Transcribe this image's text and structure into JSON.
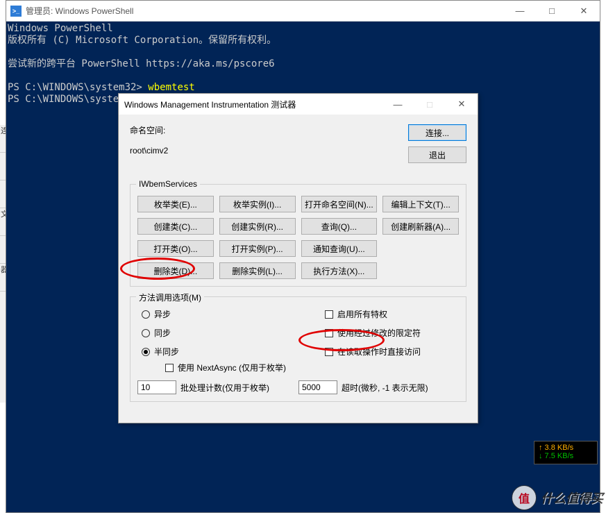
{
  "powershell": {
    "title": "管理员: Windows PowerShell",
    "lines": {
      "l1": "Windows PowerShell",
      "l2": "版权所有 (C) Microsoft Corporation。保留所有权利。",
      "l3": "尝试新的跨平台 PowerShell https://aka.ms/pscore6",
      "prompt1": "PS C:\\WINDOWS\\system32> ",
      "cmd1": "wbemtest",
      "prompt2": "PS C:\\WINDOWS\\system32> "
    }
  },
  "strip": {
    "a": "连",
    "b": " ",
    "c": " ",
    "d": "文",
    "e": " ",
    "f": "器"
  },
  "dialog": {
    "title": "Windows Management Instrumentation 测试器",
    "ns_label": "命名空间:",
    "ns_value": "root\\cimv2",
    "connect": "连接...",
    "exit": "退出",
    "group1": "IWbemServices",
    "btns": {
      "enum_class": "枚举类(E)...",
      "enum_inst": "枚举实例(I)...",
      "open_ns": "打开命名空间(N)...",
      "edit_ctx": "编辑上下文(T)...",
      "create_class": "创建类(C)...",
      "create_inst": "创建实例(R)...",
      "query": "查询(Q)...",
      "create_ref": "创建刷新器(A)...",
      "open_class": "打开类(O)...",
      "open_inst": "打开实例(P)...",
      "notif_q": "通知查询(U)...",
      "delete_class": "删除类(D)...",
      "delete_inst": "删除实例(L)...",
      "exec_method": "执行方法(X)..."
    },
    "group2": "方法调用选项(M)",
    "radios": {
      "async": "异步",
      "sync": "同步",
      "semisync": "半同步"
    },
    "checks": {
      "all_priv": "启用所有特权",
      "use_amended": "使用经过修改的限定符",
      "direct_read": "在读取操作时直接访问",
      "nextasync": "使用 NextAsync (仅用于枚举)"
    },
    "batch_label": "批处理计数(仅用于枚举)",
    "batch_value": "10",
    "timeout_label": "超时(微秒, -1 表示无限)",
    "timeout_value": "5000"
  },
  "net": {
    "up": "↑ 3.8 KB/s",
    "dn": "↓ 7.5 KB/s"
  },
  "watermark": {
    "char": "值",
    "text": "什么值得买"
  }
}
